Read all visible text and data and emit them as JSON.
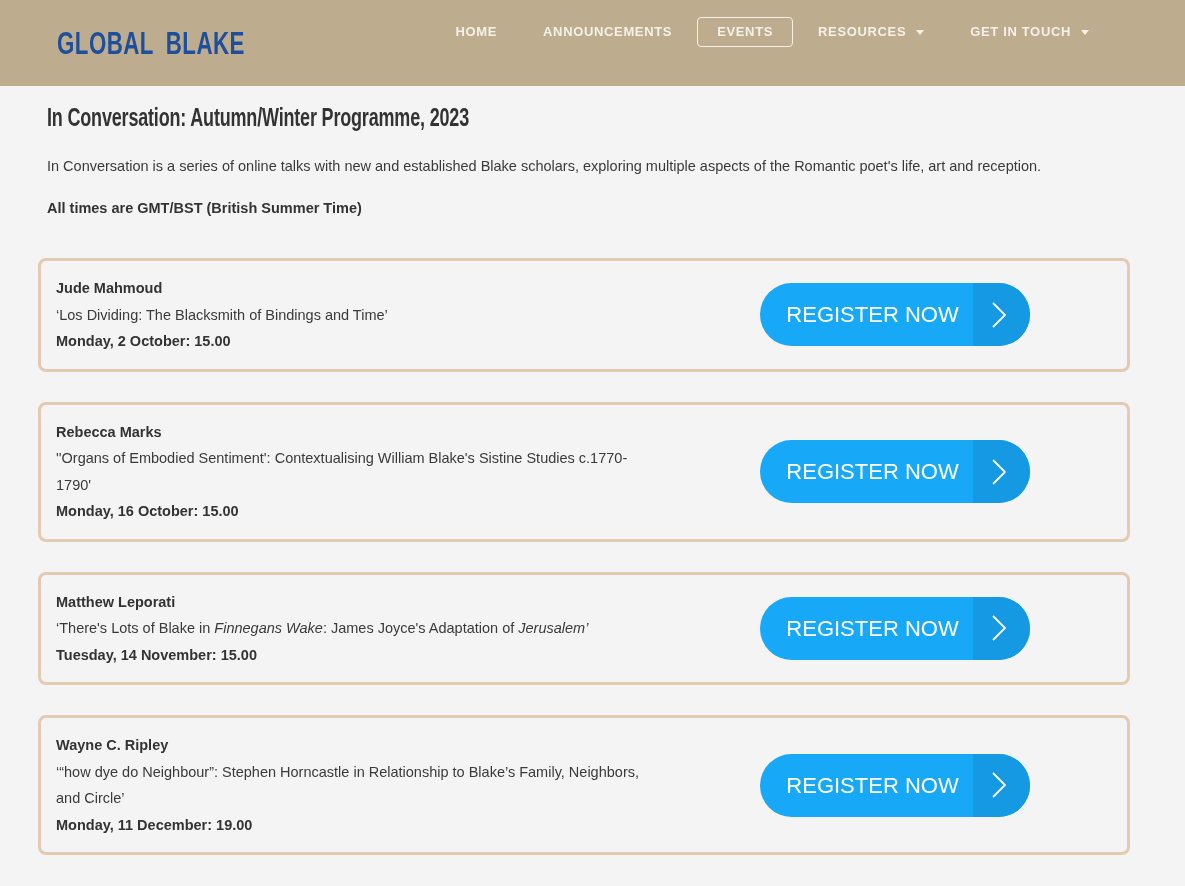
{
  "header": {
    "logo": "GLOBAL BLAKE",
    "nav": [
      {
        "label": "HOME",
        "selected": false,
        "dropdown": false
      },
      {
        "label": "ANNOUNCEMENTS",
        "selected": false,
        "dropdown": false
      },
      {
        "label": "EVENTS",
        "selected": true,
        "dropdown": false
      },
      {
        "label": "RESOURCES",
        "selected": false,
        "dropdown": true
      },
      {
        "label": "GET IN TOUCH",
        "selected": false,
        "dropdown": true
      }
    ]
  },
  "intro": {
    "title": "In Conversation: Autumn/Winter Programme, 2023",
    "description": "In Conversation is a series of online talks with new and established Blake scholars, exploring multiple aspects of the Romantic poet's life, art and reception.",
    "note": "All times are GMT/BST (British Summer Time)"
  },
  "events": [
    {
      "speaker": "Jude Mahmoud",
      "title": "‘Los Dividing: The Blacksmith of Bindings and Time’",
      "date": "Monday, 2 October: 15.00",
      "button": "REGISTER NOW"
    },
    {
      "speaker": "Rebecca Marks",
      "title": "''Organs of Embodied Sentiment': Contextualising William Blake's Sistine Studies c.1770-1790'",
      "date": "Monday, 16 October: 15.00",
      "button": "REGISTER NOW"
    },
    {
      "speaker": "Matthew Leporati",
      "title": "‘There's Lots of Blake in *Finnegans Wake*: James Joyce's Adaptation of *Jerusalem’*",
      "date": "Tuesday, 14 November: 15.00",
      "button": "REGISTER NOW"
    },
    {
      "speaker": "Wayne C. Ripley",
      "title": "‘“how dye do Neighbour”: Stephen Horncastle in Relationship to Blake’s Family, Neighbors, and Circle’",
      "date": "Monday, 11 December: 19.00",
      "button": "REGISTER NOW"
    }
  ]
}
